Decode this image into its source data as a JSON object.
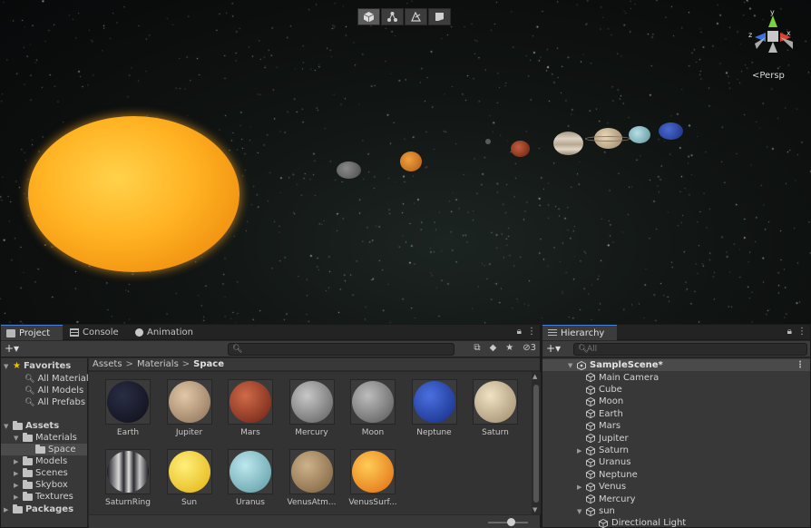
{
  "scene_view": {
    "tools": [
      {
        "name": "shaded-view-icon",
        "active": true
      },
      {
        "name": "move-snap-icon",
        "active": false
      },
      {
        "name": "draw-mode-icon",
        "active": false
      },
      {
        "name": "scene-flag-icon",
        "active": false
      }
    ],
    "gizmo": {
      "x_label": "x",
      "y_label": "y",
      "z_label": "z",
      "projection": "<Persp"
    },
    "colors": {
      "sun": "#ffb222",
      "background": "#0a0b0c"
    }
  },
  "project_panel": {
    "tabs": [
      {
        "label": "Project",
        "icon": "folder-icon",
        "active": true
      },
      {
        "label": "Console",
        "icon": "console-icon",
        "active": false
      },
      {
        "label": "Animation",
        "icon": "animation-icon",
        "active": false
      }
    ],
    "add_button": "+▾",
    "search_placeholder": "",
    "hidden_count": "3",
    "favorites": {
      "label": "Favorites",
      "items": [
        "All Materials",
        "All Models",
        "All Prefabs"
      ]
    },
    "assets_tree": {
      "label": "Assets",
      "materials": "Materials",
      "space": "Space",
      "others": [
        "Models",
        "Scenes",
        "Skybox",
        "Textures"
      ],
      "packages": "Packages"
    },
    "breadcrumb": [
      "Assets",
      "Materials",
      "Space"
    ],
    "materials": [
      {
        "name": "Earth",
        "c1": "#2a2e44",
        "c2": "#0d0e18"
      },
      {
        "name": "Jupiter",
        "c1": "#e2c8a8",
        "c2": "#8a6e55"
      },
      {
        "name": "Mars",
        "c1": "#d06a48",
        "c2": "#6a2014"
      },
      {
        "name": "Mercury",
        "c1": "#c8c8c8",
        "c2": "#5a5a5a"
      },
      {
        "name": "Moon",
        "c1": "#bdbdbd",
        "c2": "#555555"
      },
      {
        "name": "Neptune",
        "c1": "#4a70e0",
        "c2": "#142a80"
      },
      {
        "name": "Saturn",
        "c1": "#f0e2c4",
        "c2": "#9a8868"
      },
      {
        "name": "SaturnRing",
        "c1": "#d8d8d8",
        "c2": "#1a1a22"
      },
      {
        "name": "Sun",
        "c1": "#fff07a",
        "c2": "#e2b010"
      },
      {
        "name": "Uranus",
        "c1": "#bde8ee",
        "c2": "#5a98a2"
      },
      {
        "name": "VenusAtm...",
        "c1": "#ceb28c",
        "c2": "#7a5e3a"
      },
      {
        "name": "VenusSurf...",
        "c1": "#ffcc55",
        "c2": "#e06a10"
      }
    ]
  },
  "hierarchy_panel": {
    "tab_label": "Hierarchy",
    "search_placeholder": "All",
    "add_button": "+▾",
    "scene_name": "SampleScene*",
    "items": [
      {
        "label": "Main Camera",
        "expandable": false,
        "depth": 1
      },
      {
        "label": "Cube",
        "expandable": false,
        "depth": 1
      },
      {
        "label": "Moon",
        "expandable": false,
        "depth": 1
      },
      {
        "label": "Earth",
        "expandable": false,
        "depth": 1
      },
      {
        "label": "Mars",
        "expandable": false,
        "depth": 1
      },
      {
        "label": "Jupiter",
        "expandable": false,
        "depth": 1
      },
      {
        "label": "Saturn",
        "expandable": true,
        "depth": 1
      },
      {
        "label": "Uranus",
        "expandable": false,
        "depth": 1
      },
      {
        "label": "Neptune",
        "expandable": false,
        "depth": 1
      },
      {
        "label": "Venus",
        "expandable": true,
        "depth": 1
      },
      {
        "label": "Mercury",
        "expandable": false,
        "depth": 1
      },
      {
        "label": "sun",
        "expandable": true,
        "expanded": true,
        "depth": 1
      },
      {
        "label": "Directional Light",
        "expandable": false,
        "depth": 2
      }
    ]
  }
}
